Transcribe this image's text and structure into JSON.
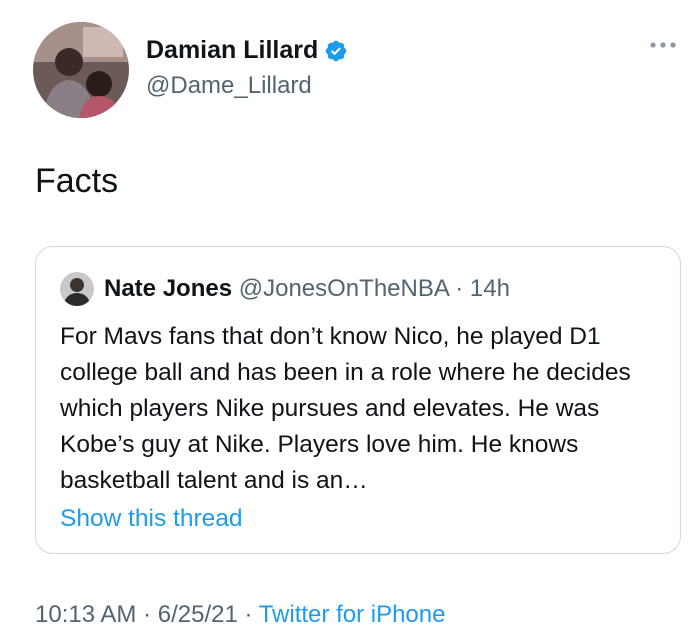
{
  "author": {
    "name": "Damian Lillard",
    "handle": "@Dame_Lillard",
    "verified_icon": "verified-badge-icon",
    "more_icon": "more-options-icon"
  },
  "tweet": {
    "text": "Facts"
  },
  "quoted_tweet": {
    "name": "Nate Jones",
    "handle": "@JonesOnTheNBA",
    "separator": " · ",
    "time": "14h",
    "body": "For Mavs fans that don’t know Nico, he played D1 college ball and has been in a role where he decides which players Nike pursues and elevates. He was Kobe’s guy at Nike. Players love him. He knows basketball talent and is an…",
    "show_thread": "Show this thread"
  },
  "meta": {
    "time": "10:13 AM",
    "sep1": " · ",
    "date": "6/25/21",
    "sep2": " · ",
    "source": "Twitter for iPhone"
  },
  "colors": {
    "accent": "#1d9bf0",
    "secondary_text": "#536471",
    "border": "#cfd9de"
  }
}
